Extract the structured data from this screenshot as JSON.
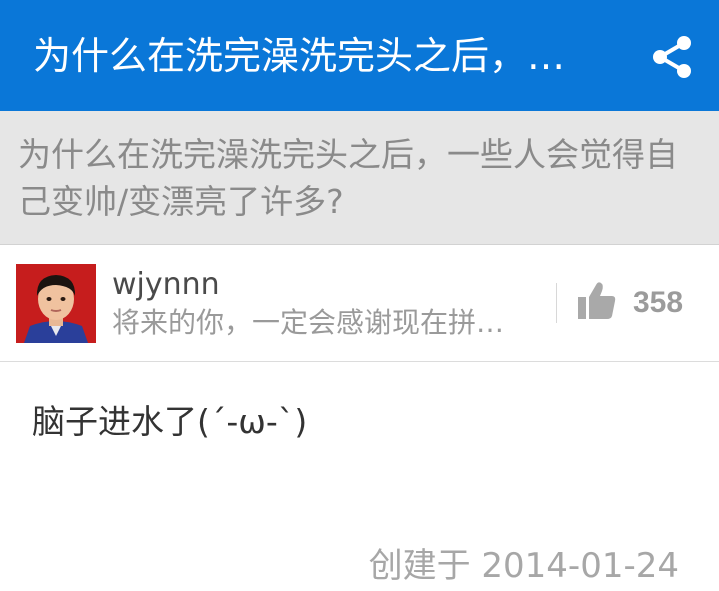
{
  "appbar": {
    "title": "为什么在洗完澡洗完头之后，…",
    "background": "#0a77d8",
    "share_icon": "share-icon"
  },
  "question": {
    "text": "为什么在洗完澡洗完头之后，一些人会觉得自己变帅/变漂亮了许多?"
  },
  "author": {
    "name": "wjynnn",
    "bio": "将来的你，一定会感谢现在拼…",
    "avatar_icon": "avatar"
  },
  "vote": {
    "icon": "thumbs-up-icon",
    "count": "358"
  },
  "answer": {
    "text": "脑子进水了(´-ω-`)"
  },
  "footer": {
    "created": "创建于 2014-01-24"
  }
}
